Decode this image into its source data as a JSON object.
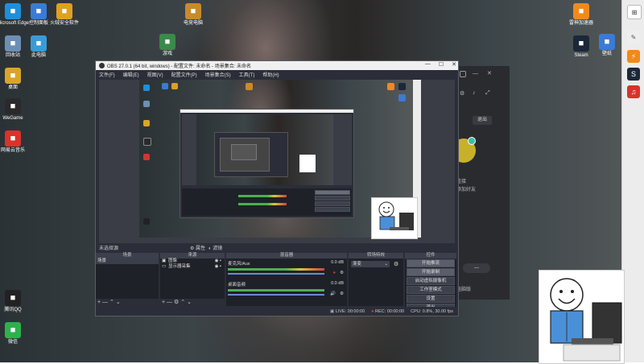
{
  "desktop_left_icons": [
    {
      "label": "Microsoft Edge",
      "icon": "edge-icon",
      "color": "#1f8fd8"
    },
    {
      "label": "回收站",
      "icon": "recycle-bin-icon",
      "color": "#6c8fb5"
    },
    {
      "label": "桌面",
      "icon": "folder-icon",
      "color": "#d9a528"
    },
    {
      "label": "WeGame",
      "icon": "wegame-icon",
      "color": "#2a2a2a"
    },
    {
      "label": "网易云音乐",
      "icon": "netease-music-icon",
      "color": "#d9332b"
    },
    {
      "label": "腾讯QQ",
      "icon": "qq-icon",
      "color": "#222"
    },
    {
      "label": "微信",
      "icon": "wechat-icon",
      "color": "#2bb24c"
    }
  ],
  "desktop_col2_icons": [
    {
      "label": "控制面板",
      "icon": "control-panel-icon",
      "color": "#3a7bd5"
    },
    {
      "label": "此电脑",
      "icon": "computer-icon",
      "color": "#3a9bd5"
    }
  ],
  "desktop_col3_icons": [
    {
      "label": "火绒安全软件",
      "icon": "huorong-icon",
      "color": "#e0a020"
    }
  ],
  "desktop_center_icons": [
    {
      "label": "电竞电脑",
      "icon": "pubg-icon",
      "color": "#c98a2a"
    },
    {
      "label": "游戏",
      "icon": "game-icon",
      "color": "#3a8a4a"
    }
  ],
  "desktop_right_icons": [
    {
      "label": "雷神加速器",
      "icon": "leishen-icon",
      "color": "#f08a1a"
    },
    {
      "label": "Steam",
      "icon": "steam-icon",
      "color": "#1b2838"
    },
    {
      "label": "壁纸",
      "icon": "wallpaper-icon",
      "color": "#3a7bd5"
    }
  ],
  "obs": {
    "title": "OBS 27.0.1 (64 bit, windows) - 配置文件: 未命名 - 场景集合: 未命名",
    "menu": [
      "文件(F)",
      "编辑(E)",
      "视图(V)",
      "配置文件(P)",
      "场景集合(S)",
      "工具(T)",
      "帮助(H)"
    ],
    "scene_label": "未选择源",
    "preview_tabs": [
      "属性",
      "滤镜"
    ],
    "docks": {
      "scenes_title": "场景",
      "scene_item": "场景",
      "sources_title": "来源",
      "sources": [
        "图像",
        "显示器采集"
      ],
      "mixer_title": "混音器",
      "mixer_tracks": [
        {
          "name": "麦克风/Aux",
          "db": "0.0 dB"
        },
        {
          "name": "桌面音频",
          "db": "0.0 dB"
        }
      ],
      "transitions_title": "转场特效",
      "transition_value": "渐变",
      "controls_title": "控件",
      "controls": [
        "开始推流",
        "开始录制",
        "启动虚拟摄像机",
        "工作室模式",
        "设置",
        "退出"
      ]
    },
    "status": {
      "live": "LIVE: 00:00:00",
      "rec": "REC: 00:00:00",
      "cpu": "CPU: 0.8%, 30.00 fps"
    }
  },
  "bg_panel": {
    "button_exit": "退出",
    "text1": "连接",
    "text2": "添加好友",
    "bottom_text": "电脑版"
  },
  "colors": {
    "obs_bg": "#2b2e38",
    "controls_btn": "#3d414c",
    "accent_red": "#c94545"
  }
}
